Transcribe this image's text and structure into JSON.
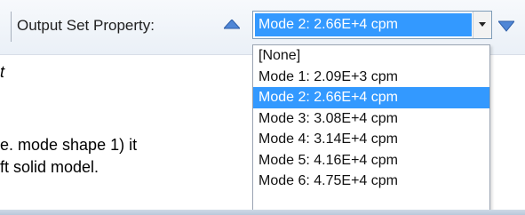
{
  "toolbar": {
    "label": "Output Set Property:",
    "selected_value": "Mode 2:  2.66E+4 cpm",
    "prev_icon": "arrow-up-icon",
    "next_icon": "arrow-down-icon",
    "dropdown_icon": "chevron-down-icon",
    "accent_color": "#3399ff"
  },
  "dropdown": {
    "options": [
      {
        "label": "[None]"
      },
      {
        "label": "Mode 1:  2.09E+3 cpm"
      },
      {
        "label": "Mode 2:  2.66E+4 cpm"
      },
      {
        "label": "Mode 3:  3.08E+4 cpm"
      },
      {
        "label": "Mode 4:  3.14E+4 cpm"
      },
      {
        "label": "Mode 5:  4.16E+4 cpm"
      },
      {
        "label": "Mode 6:  4.75E+4 cpm"
      }
    ],
    "selected_index": 2
  },
  "background_text": {
    "fragment_t": "t",
    "line1": "e. mode shape  1) it",
    "line2": "ft solid  model."
  }
}
